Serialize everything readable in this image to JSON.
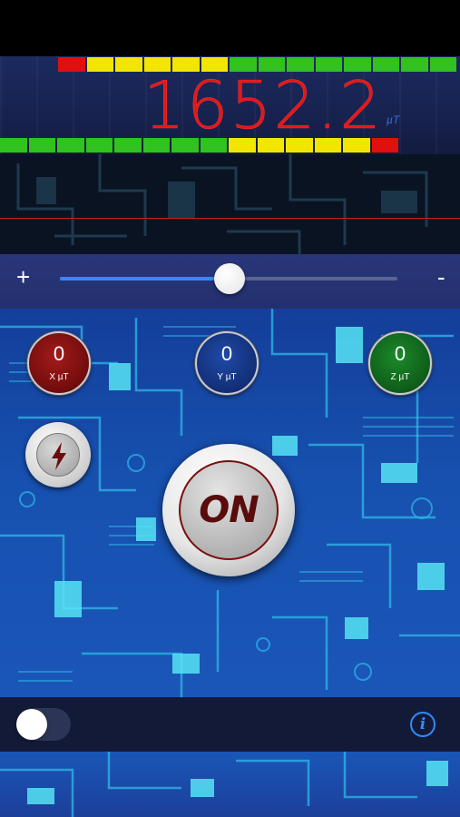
{
  "meter": {
    "reading": "1652.2",
    "unit": "µT",
    "led_top": [
      "#e01010",
      "#f2e600",
      "#f2e600",
      "#f2e600",
      "#f2e600",
      "#f2e600",
      "#31c21f",
      "#31c21f",
      "#31c21f",
      "#31c21f",
      "#31c21f",
      "#31c21f",
      "#31c21f",
      "#31c21f"
    ],
    "led_bottom": [
      "#31c21f",
      "#31c21f",
      "#31c21f",
      "#31c21f",
      "#31c21f",
      "#31c21f",
      "#31c21f",
      "#31c21f",
      "#f2e600",
      "#f2e600",
      "#f2e600",
      "#f2e600",
      "#f2e600",
      "#e01010"
    ]
  },
  "slider": {
    "plus_label": "+",
    "minus_label": "-",
    "level_percent": 51
  },
  "axes": [
    {
      "value": "0",
      "label": "X µT",
      "color": "#a31b1b"
    },
    {
      "value": "0",
      "label": "Y µT",
      "color": "#1f4aa8"
    },
    {
      "value": "0",
      "label": "Z µT",
      "color": "#1b8a2a"
    }
  ],
  "power_button": {
    "label": "ON"
  },
  "flash_button": {
    "icon": "lightning-bolt-icon"
  },
  "bottom_bar": {
    "toggle_on": false,
    "info_label": "i"
  }
}
